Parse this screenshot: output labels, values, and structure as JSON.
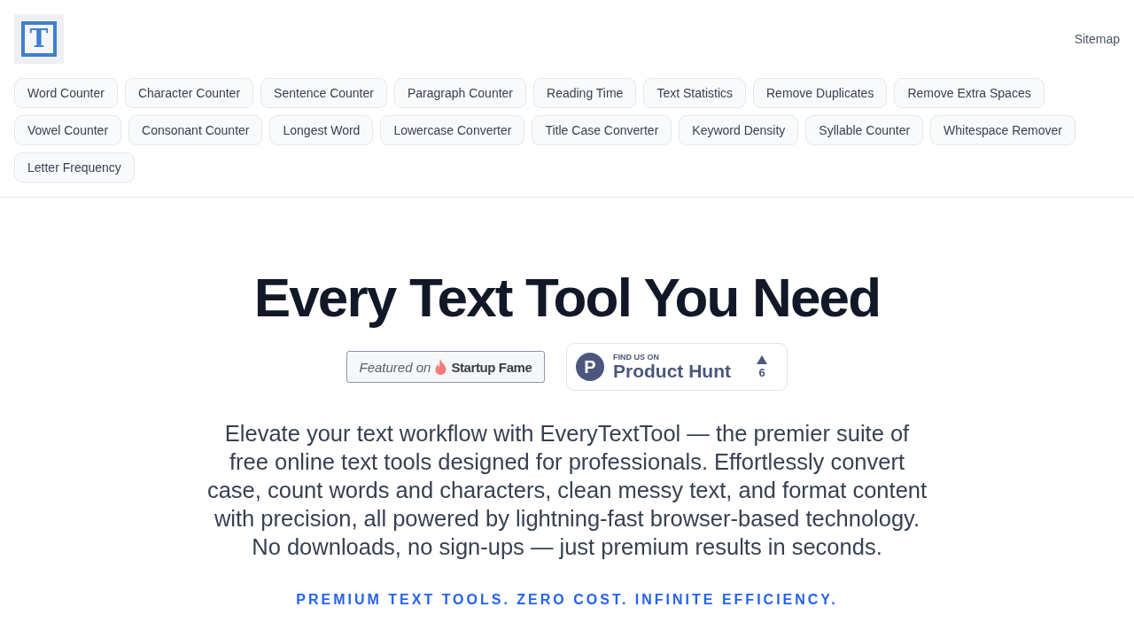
{
  "header": {
    "logo": {
      "letter": "T"
    },
    "links": [
      {
        "label": "Sitemap"
      }
    ]
  },
  "nav": {
    "items": [
      "Word Counter",
      "Character Counter",
      "Sentence Counter",
      "Paragraph Counter",
      "Reading Time",
      "Text Statistics",
      "Remove Duplicates",
      "Remove Extra Spaces",
      "Vowel Counter",
      "Consonant Counter",
      "Longest Word",
      "Lowercase Converter",
      "Title Case Converter",
      "Keyword Density",
      "Syllable Counter",
      "Whitespace Remover",
      "Letter Frequency"
    ]
  },
  "hero": {
    "title": "Every Text Tool You Need",
    "badges": [
      {
        "kind": "startup_fame",
        "prefix": "Featured on",
        "name": "Startup Fame"
      },
      {
        "kind": "product_hunt",
        "logo_letter": "P",
        "caption": "FIND US ON",
        "name": "Product Hunt",
        "upvotes": "6"
      }
    ],
    "description": "Elevate your text workflow with EveryTextTool — the premier suite of free online text tools designed for professionals. Effortlessly convert case, count words and characters, clean messy text, and format content with precision, all powered by lightning-fast browser-based technology. No downloads, no sign-ups — just premium results in seconds.",
    "tagline": "PREMIUM TEXT TOOLS. ZERO COST. INFINITE EFFICIENCY."
  }
}
